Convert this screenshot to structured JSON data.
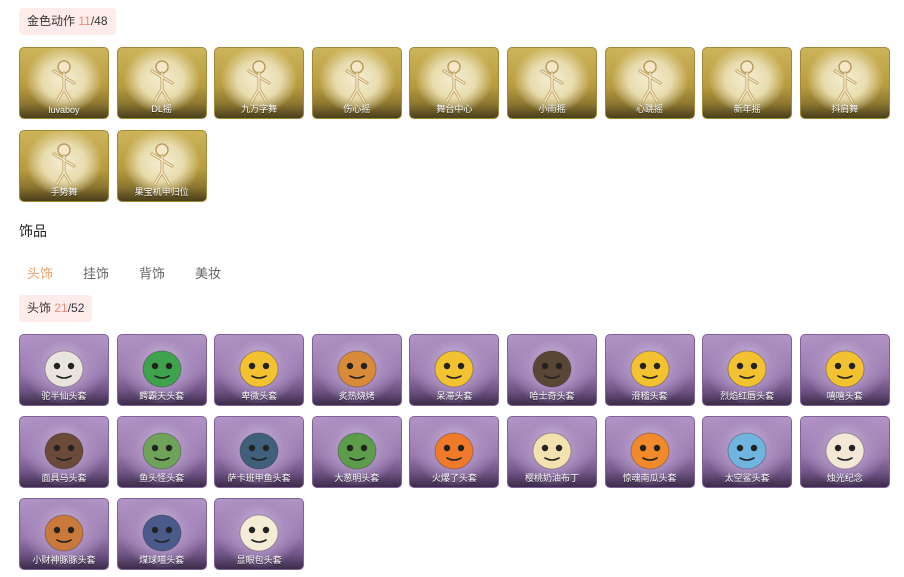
{
  "gold_section": {
    "label": "金色动作",
    "count": "11",
    "total": "/48",
    "items": [
      "luvaboy",
      "DL摇",
      "九万字舞",
      "伤心摇",
      "舞台中心",
      "小雨摇",
      "心跳摇",
      "新年摇",
      "抖肩舞",
      "手势舞",
      "果宝机甲归位"
    ]
  },
  "accessories": {
    "title": "饰品",
    "tabs": [
      "头饰",
      "挂饰",
      "背饰",
      "美妆"
    ],
    "active_tab": "头饰"
  },
  "head_section": {
    "label": "头饰",
    "count": "21",
    "total": "/52",
    "items": [
      "驼半仙头套",
      "鳄霸天头套",
      "卑微头套",
      "炙热烧烤",
      "呆滞头套",
      "哈士奇头套",
      "滑稽头套",
      "烈焰红唇头套",
      "嘻嘻头套",
      "面具马头套",
      "鱼头怪头套",
      "萨卡班甲鱼头套",
      "大葱明头套",
      "火爆了头套",
      "樱桃奶油布丁",
      "惊魂南瓜头套",
      "太空鲨头套",
      "烛光纪念",
      "小财神豚豚头套",
      "煤球喵头套",
      "显眼包头套"
    ]
  },
  "colors": {
    "accent": "#f0a06a",
    "pill_bg": "#fdecea",
    "count": "#f08a7a",
    "gold_tile": "#b79b3e",
    "purple_tile": "#9778ad"
  }
}
